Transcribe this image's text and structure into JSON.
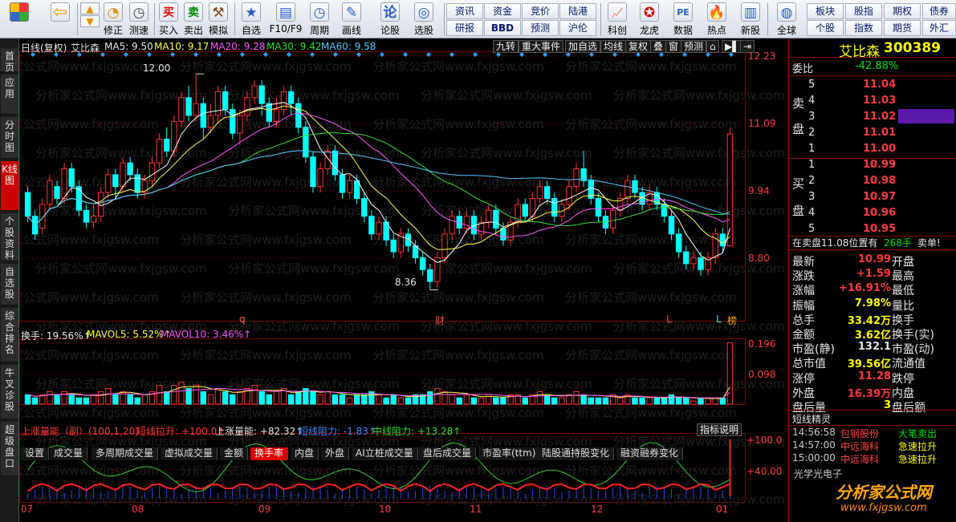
{
  "toolbar": {
    "buttons": [
      {
        "label": "",
        "icon": "app-grid-icon"
      },
      {
        "label": "",
        "icon": "back-arrow-icon"
      },
      {
        "label": "修正",
        "icon": "adjust-icon"
      },
      {
        "label": "测速",
        "icon": "clock-icon"
      },
      {
        "label": "买入",
        "icon": "buy-icon"
      },
      {
        "label": "卖出",
        "icon": "sell-icon"
      },
      {
        "label": "模拟",
        "icon": "hammer-icon"
      },
      {
        "label": "自选",
        "icon": "star-icon"
      },
      {
        "label": "F10/F9",
        "icon": "f10-icon"
      },
      {
        "label": "周期",
        "icon": "period-icon"
      },
      {
        "label": "画线",
        "icon": "pen-icon"
      },
      {
        "label": "论股",
        "icon": "discuss-icon"
      },
      {
        "label": "选股",
        "icon": "screen-icon"
      }
    ],
    "grid_buttons": [
      "资讯",
      "资金",
      "竞价",
      "陆港",
      "研报",
      "BBD",
      "预测",
      "沪伦"
    ],
    "buttons2": [
      {
        "label": "科创",
        "icon": "kechuang-icon"
      },
      {
        "label": "龙虎",
        "icon": "tiger-icon"
      },
      {
        "label": "数据",
        "icon": "pe-icon"
      },
      {
        "label": "热点",
        "icon": "hot-icon"
      },
      {
        "label": "新股",
        "icon": "newstock-icon"
      },
      {
        "label": "全球",
        "icon": "globe-icon"
      }
    ],
    "grid_buttons2": [
      "板块",
      "股指",
      "期权",
      "债券",
      "个股",
      "指数",
      "期货",
      "外汇"
    ]
  },
  "left_tabs": [
    "首页",
    "应用",
    "分时图",
    "K线图",
    "个股资料",
    "自选股",
    "综合排名",
    "牛叉诊股",
    "超级盘口"
  ],
  "chart_header": {
    "title": "日线(复权)",
    "stock": "艾比森",
    "ma5": "MA5: 9.50",
    "ma10": "MA10: 9.17",
    "ma20": "MA20: 9.28",
    "ma30": "MA30: 9.42",
    "ma60": "MA60: 9.58",
    "menu": [
      "九转",
      "重大事件",
      "加自选",
      "均线",
      "复权",
      "叠",
      "窗",
      "预测"
    ]
  },
  "price_axis": [
    "12.23",
    "11.09",
    "9.94",
    "8.80"
  ],
  "annotations": {
    "high": "12.00",
    "low": "8.36",
    "mark_q": "q",
    "mark_cai": "财",
    "mark_l1": "L",
    "mark_l2": "L",
    "mark_bang": "榜"
  },
  "volume_header": {
    "a": "换手: 19.56%↑",
    "b": "MAVOL5: 5.52%↑",
    "c": "MAVOL10: 3.46%↑"
  },
  "volume_axis": [
    "0.196",
    "0.098"
  ],
  "bottom_tabs": [
    "设置",
    "成交量",
    "多周期成交量",
    "虚拟成交量",
    "金额",
    "换手率",
    "内盘",
    "外盘",
    "AI立桩成交量",
    "盘后成交量",
    "市盈率(ttm)",
    "陆股通持股变化",
    "融资融券变化"
  ],
  "indicator": {
    "name": "上涨量能（副）(100,1,20)",
    "a": "短线拉升: +100.0↑",
    "b": "上涨量能: +82.32↑",
    "c": "短线阻力: -1.83↑",
    "d": "中线阻力: +13.28↑",
    "explain": "指标说明",
    "axis": [
      "+100.0",
      "+40.00"
    ]
  },
  "dates": [
    "07",
    "08",
    "09",
    "10",
    "11",
    "12",
    "01"
  ],
  "watermark": "分析家公式网www.fxjgsw.com",
  "chart_data": {
    "type": "candlestick",
    "ylim": [
      8.0,
      12.3
    ],
    "candles": [
      [
        10.0,
        9.6,
        10.1,
        9.5
      ],
      [
        9.6,
        9.3,
        9.7,
        9.2
      ],
      [
        9.4,
        9.8,
        9.9,
        9.3
      ],
      [
        9.8,
        10.2,
        10.3,
        9.7
      ],
      [
        10.1,
        9.9,
        10.2,
        9.8
      ],
      [
        9.9,
        10.4,
        10.5,
        9.8
      ],
      [
        10.4,
        10.1,
        10.5,
        10.0
      ],
      [
        10.1,
        9.7,
        10.2,
        9.6
      ],
      [
        9.7,
        9.5,
        9.8,
        9.4
      ],
      [
        9.5,
        9.6,
        9.8,
        9.4
      ],
      [
        9.6,
        10.0,
        10.1,
        9.5
      ],
      [
        10.0,
        10.3,
        10.4,
        9.9
      ],
      [
        10.3,
        10.1,
        10.4,
        9.9
      ],
      [
        10.1,
        10.5,
        10.6,
        10.0
      ],
      [
        10.5,
        10.3,
        10.6,
        10.2
      ],
      [
        10.3,
        10.0,
        10.4,
        9.9
      ],
      [
        10.0,
        10.2,
        10.3,
        9.9
      ],
      [
        10.2,
        10.5,
        10.6,
        10.1
      ],
      [
        10.5,
        10.9,
        11.0,
        10.4
      ],
      [
        10.9,
        10.7,
        11.1,
        10.6
      ],
      [
        10.7,
        11.2,
        11.3,
        10.6
      ],
      [
        11.2,
        11.6,
        11.7,
        11.1
      ],
      [
        11.6,
        11.3,
        11.8,
        11.2
      ],
      [
        11.3,
        11.5,
        12.0,
        11.2
      ],
      [
        11.5,
        11.1,
        11.6,
        10.9
      ],
      [
        11.1,
        11.3,
        11.5,
        11.0
      ],
      [
        11.3,
        11.7,
        11.8,
        11.2
      ],
      [
        11.7,
        11.4,
        11.8,
        11.3
      ],
      [
        11.4,
        11.0,
        11.5,
        10.9
      ],
      [
        11.0,
        11.3,
        11.4,
        10.8
      ],
      [
        11.3,
        11.6,
        11.7,
        11.2
      ],
      [
        11.6,
        11.8,
        11.9,
        11.5
      ],
      [
        11.8,
        11.5,
        11.9,
        11.3
      ],
      [
        11.5,
        11.2,
        11.6,
        11.1
      ],
      [
        11.2,
        11.4,
        11.6,
        11.1
      ],
      [
        11.4,
        11.7,
        11.8,
        11.3
      ],
      [
        11.7,
        11.5,
        11.8,
        11.3
      ],
      [
        11.5,
        11.1,
        11.6,
        11.0
      ],
      [
        11.1,
        10.6,
        11.2,
        10.5
      ],
      [
        10.6,
        10.1,
        10.7,
        10.0
      ],
      [
        10.1,
        10.4,
        10.5,
        10.0
      ],
      [
        10.4,
        10.7,
        10.8,
        10.3
      ],
      [
        10.7,
        10.3,
        10.8,
        10.2
      ],
      [
        10.3,
        10.0,
        10.4,
        9.9
      ],
      [
        10.0,
        10.2,
        10.3,
        9.9
      ],
      [
        10.2,
        9.9,
        10.3,
        9.8
      ],
      [
        9.9,
        9.6,
        10.0,
        9.5
      ],
      [
        9.6,
        9.3,
        9.7,
        9.2
      ],
      [
        9.3,
        9.5,
        9.6,
        9.2
      ],
      [
        9.5,
        9.2,
        9.6,
        9.1
      ],
      [
        9.2,
        9.0,
        9.3,
        8.9
      ],
      [
        9.0,
        9.3,
        9.4,
        8.9
      ],
      [
        9.3,
        9.1,
        9.4,
        9.0
      ],
      [
        9.1,
        8.9,
        9.2,
        8.8
      ],
      [
        8.9,
        8.7,
        9.0,
        8.6
      ],
      [
        8.7,
        8.5,
        8.8,
        8.36
      ],
      [
        8.5,
        8.9,
        9.0,
        8.4
      ],
      [
        8.9,
        9.3,
        9.4,
        8.8
      ],
      [
        9.3,
        9.6,
        9.7,
        9.2
      ],
      [
        9.6,
        9.4,
        9.7,
        9.3
      ],
      [
        9.4,
        9.6,
        9.7,
        9.3
      ],
      [
        9.6,
        9.3,
        9.7,
        9.2
      ],
      [
        9.3,
        9.5,
        9.6,
        9.2
      ],
      [
        9.5,
        9.7,
        9.8,
        9.4
      ],
      [
        9.7,
        9.4,
        9.8,
        9.3
      ],
      [
        9.4,
        9.2,
        9.5,
        9.1
      ],
      [
        9.2,
        9.5,
        9.6,
        9.1
      ],
      [
        9.5,
        9.8,
        9.9,
        9.4
      ],
      [
        9.8,
        9.6,
        9.9,
        9.5
      ],
      [
        9.6,
        9.9,
        10.0,
        9.5
      ],
      [
        9.9,
        10.1,
        10.2,
        9.8
      ],
      [
        10.1,
        9.9,
        10.2,
        9.8
      ],
      [
        9.9,
        9.6,
        10.0,
        9.5
      ],
      [
        9.6,
        9.8,
        9.9,
        9.5
      ],
      [
        9.8,
        10.1,
        10.2,
        9.7
      ],
      [
        10.1,
        10.4,
        10.5,
        10.0
      ],
      [
        10.4,
        10.2,
        10.7,
        10.1
      ],
      [
        10.2,
        9.9,
        10.3,
        9.8
      ],
      [
        9.9,
        9.6,
        10.0,
        9.5
      ],
      [
        9.6,
        9.4,
        9.7,
        9.3
      ],
      [
        9.4,
        9.7,
        9.8,
        9.3
      ],
      [
        9.7,
        9.9,
        10.0,
        9.6
      ],
      [
        9.9,
        10.2,
        10.3,
        9.8
      ],
      [
        10.2,
        10.0,
        10.3,
        9.9
      ],
      [
        10.0,
        9.8,
        10.1,
        9.7
      ],
      [
        9.8,
        10.0,
        10.1,
        9.7
      ],
      [
        10.0,
        9.8,
        10.1,
        9.7
      ],
      [
        9.8,
        9.6,
        9.9,
        9.5
      ],
      [
        9.6,
        9.3,
        9.7,
        9.2
      ],
      [
        9.3,
        9.0,
        9.4,
        8.9
      ],
      [
        9.0,
        8.8,
        9.1,
        8.7
      ],
      [
        8.8,
        8.9,
        9.0,
        8.7
      ],
      [
        8.9,
        8.7,
        9.0,
        8.6
      ],
      [
        8.7,
        8.9,
        9.0,
        8.6
      ],
      [
        8.9,
        9.3,
        9.4,
        8.8
      ],
      [
        9.3,
        9.1,
        9.4,
        9.0
      ],
      [
        9.1,
        10.99,
        11.09,
        9.9
      ]
    ],
    "volume": [
      0.03,
      0.02,
      0.03,
      0.04,
      0.03,
      0.04,
      0.03,
      0.02,
      0.02,
      0.03,
      0.04,
      0.05,
      0.03,
      0.04,
      0.03,
      0.02,
      0.03,
      0.04,
      0.06,
      0.04,
      0.06,
      0.07,
      0.05,
      0.06,
      0.04,
      0.03,
      0.05,
      0.04,
      0.03,
      0.04,
      0.05,
      0.06,
      0.04,
      0.03,
      0.04,
      0.05,
      0.03,
      0.04,
      0.05,
      0.04,
      0.03,
      0.04,
      0.03,
      0.03,
      0.02,
      0.03,
      0.03,
      0.04,
      0.03,
      0.02,
      0.03,
      0.02,
      0.02,
      0.03,
      0.03,
      0.04,
      0.05,
      0.04,
      0.03,
      0.02,
      0.03,
      0.02,
      0.02,
      0.03,
      0.02,
      0.02,
      0.03,
      0.03,
      0.02,
      0.03,
      0.04,
      0.03,
      0.02,
      0.02,
      0.03,
      0.04,
      0.03,
      0.02,
      0.02,
      0.02,
      0.03,
      0.02,
      0.03,
      0.02,
      0.02,
      0.02,
      0.02,
      0.02,
      0.03,
      0.02,
      0.02,
      0.01,
      0.02,
      0.02,
      0.02,
      0.02,
      0.196
    ],
    "vol_ylim": [
      0,
      0.2
    ]
  },
  "quote": {
    "name": "艾比森",
    "code": "300389",
    "weibi_label": "委比",
    "weibi": "-42.88%",
    "sell_label": [
      "卖",
      "盘"
    ],
    "buy_label": [
      "买",
      "盘"
    ],
    "asks": [
      {
        "n": "5",
        "p": "11.04"
      },
      {
        "n": "4",
        "p": "11.03"
      },
      {
        "n": "3",
        "p": "11.02"
      },
      {
        "n": "2",
        "p": "11.01"
      },
      {
        "n": "1",
        "p": "11.00"
      }
    ],
    "bids": [
      {
        "n": "1",
        "p": "10.99"
      },
      {
        "n": "2",
        "p": "10.98"
      },
      {
        "n": "3",
        "p": "10.97"
      },
      {
        "n": "4",
        "p": "10.96"
      },
      {
        "n": "5",
        "p": "10.95"
      }
    ],
    "status_a": "在卖盘11.08位置有",
    "status_b": "268手",
    "status_c": "卖单!",
    "stats": [
      {
        "l": "最新",
        "v": "10.99",
        "l2": "开盘",
        "v2": ""
      },
      {
        "l": "涨跌",
        "v": "+1.59",
        "l2": "最高",
        "v2": ""
      },
      {
        "l": "涨幅",
        "v": "+16.91%",
        "l2": "最低",
        "v2": ""
      },
      {
        "l": "振幅",
        "v": "7.98%",
        "l2": "量比",
        "v2": ""
      },
      {
        "l": "总手",
        "v": "33.42万",
        "l2": "换手",
        "v2": ""
      },
      {
        "l": "金额",
        "v": "3.62亿",
        "l2": "换手(实)",
        "v2": ""
      },
      {
        "l": "市盈(静)",
        "v": "132.1",
        "l2": "市盈(动)",
        "v2": ""
      },
      {
        "l": "总市值",
        "v": "39.56亿",
        "l2": "流通值",
        "v2": ""
      },
      {
        "l": "涨停",
        "v": "11.28",
        "l2": "跌停",
        "v2": ""
      },
      {
        "l": "外盘",
        "v": "16.39万",
        "l2": "内盘",
        "v2": ""
      },
      {
        "l": "盘后量",
        "v": "3",
        "l2": "盘后额",
        "v2": ""
      }
    ],
    "sprite_title": "短线精灵",
    "sprite": [
      {
        "t": "14:56:58",
        "s": "包钢股份",
        "e": "大笔卖出"
      },
      {
        "t": "14:57:00",
        "s": "中远海科",
        "e": "急速拉升"
      },
      {
        "t": "15:00:00",
        "s": "中远海科",
        "e": "急速拉升"
      }
    ],
    "sprite_partial": "光学光电子"
  },
  "logo": {
    "text": "分析家公式网",
    "url": "www.fxjgsw.com"
  }
}
